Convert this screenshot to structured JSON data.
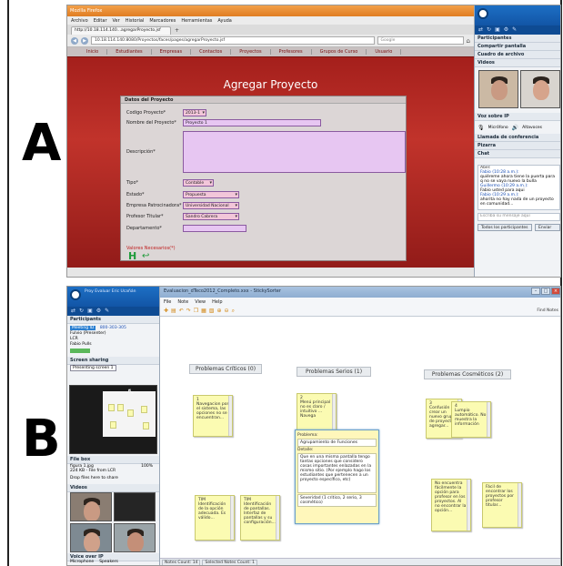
{
  "labels": {
    "a": "A",
    "b": "B"
  },
  "panel_a": {
    "browser": {
      "window_title": "Mozilla Firefox",
      "menu": [
        "Archivo",
        "Editar",
        "Ver",
        "Historial",
        "Marcadores",
        "Herramientas",
        "Ayuda"
      ],
      "tab_label": "http://10.18.114.140...agregarProyecto.jsf",
      "url": "10.18.114.140:8080/Proyectos/faces/pages/agregarProyecto.jsf",
      "search_placeholder": "Google"
    },
    "site_nav": [
      "Inicio",
      "Estudiantes",
      "Empresas",
      "Contactos",
      "Proyectos",
      "Profesores",
      "Grupos de Curso",
      "Usuario"
    ],
    "heading": "Agregar Proyecto",
    "form": {
      "section_title": "Datos del Proyecto",
      "fields": {
        "codigo": {
          "label": "Codigo Proyecto*",
          "value": "2013-1"
        },
        "nombre": {
          "label": "Nombre del Proyecto*",
          "value": "Proyecto 1"
        },
        "descripcion": {
          "label": "Descripción*",
          "value": ""
        },
        "tipo": {
          "label": "Tipo*",
          "value": "Contable"
        },
        "estado": {
          "label": "Estado*",
          "value": "Propuesta"
        },
        "empresa": {
          "label": "Empresa Patrocinadora*",
          "value": "Universidad Nacional"
        },
        "profesor": {
          "label": "Profesor Titular*",
          "value": "Sandro Cabrera"
        },
        "departamento": {
          "label": "Departamento*",
          "value": ""
        }
      },
      "required_note": "Valores Necesarios(*)",
      "save_icon": "save-icon",
      "back_icon": "back-arrow-icon"
    },
    "side_panel": {
      "sections": [
        "Participantes",
        "Compartir pantalla",
        "Cuadro de archivo",
        "Videos",
        "Voz sobre IP",
        "Llamada de conferencia",
        "Pizarra",
        "Chat"
      ],
      "mic_label": "Micrófono",
      "speaker_label": "Altavoces",
      "chat_lines": [
        "Abel:",
        "Fabio (10:28 a.m.):",
        "quiéreme ahora tiene la puerta para q no se vaya nuevo la bulla",
        "Guillermo (10:29 a.m.):",
        "Fabio usted para aqui",
        "Fabio (10:29 a.m.):",
        "ahorita no hay nada de un proyecto en comunidad..."
      ],
      "chat_placeholder": "Escriba su mensaje aquí",
      "recipient": "Todos los participantes",
      "send_label": "Enviar"
    }
  },
  "panel_b": {
    "side_panel": {
      "title": "Proy Evaluar Eric Ucañán",
      "sections": [
        "Participants",
        "Screen sharing",
        "File box",
        "Videos",
        "Voice over IP"
      ],
      "meeting_id_label": "Meeting ID",
      "meeting_id": "800-303-305",
      "participants": [
        "Fulvio (Presenter)",
        "LCR",
        "Fabio Pulls"
      ],
      "presenting_label": "Presenting screen 1",
      "file_name": "figura 1.jpg",
      "file_meta": "224 KB - File from LCR",
      "file_percent": "100%",
      "drop_label": "Drop files here to share",
      "mic_label": "Microphone",
      "speaker_label": "Speakers"
    },
    "app": {
      "window_title": "Evaluacion_dTeco2012_Completo.xxx - StickySorter",
      "menu": [
        "File",
        "Note",
        "View",
        "Help"
      ],
      "find_label": "Find Notes",
      "columns": [
        {
          "label": "Problemas Críticos",
          "count": "(0)"
        },
        {
          "label": "Problemas Serios",
          "count": "(1)"
        },
        {
          "label": "Problemas Cosméticos",
          "count": "(2)"
        }
      ],
      "notes": [
        {
          "id": "1",
          "text": "Navegacion por el sistema, las opciones no se encuentran..."
        },
        {
          "id": "2",
          "text": "Menú principal no es claro / intuitivo ... Navega"
        },
        {
          "id": "3",
          "text": "Confusión a crear un nuevo grupo de proyecto / agregar..."
        },
        {
          "id": "4",
          "text": "Lumpio automático. No muestra la información"
        },
        {
          "id": "5",
          "text": "TIM Identificación de la opción adecuada. Es válido..."
        },
        {
          "id": "6",
          "text": "TIM Identificación de pantallas. Interfaz de pantallas y su configuración..."
        },
        {
          "id": "7",
          "text": "No encuentra fácilmente la opción para profesor en los proyectos. Al no encontrar la opción..."
        },
        {
          "id": "8",
          "text": "Fácil de encontrar los proyectos por profesor titular..."
        }
      ],
      "editor": {
        "problem_label": "Problema:",
        "problem_value": "Agrupamiento de Funciones",
        "detail_label": "Detalle:",
        "detail_value": "Que en una misma pantalla tengo tantas opciones que considero cosas importantes enlazadas en la mismo sitio. (Por ejemplo hago los estudiantes que pertenecen a un proyecto específico, etc)",
        "severity_value": "Severidad (1 critico, 2 serio, 3 cosmético)"
      },
      "status": [
        "Notes Count: 14",
        "Selected Notes Count: 1"
      ]
    }
  }
}
